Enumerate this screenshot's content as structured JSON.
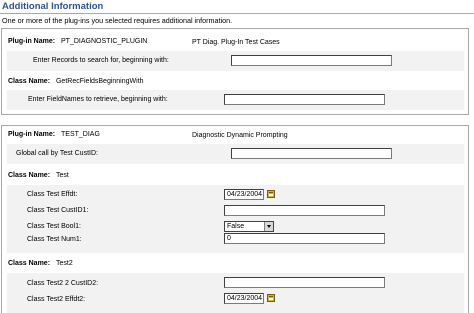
{
  "page": {
    "title": "Additional Information",
    "intro": "One or more of the plug-ins you selected requires additional information."
  },
  "plugin1": {
    "plugin_label": "Plug-in Name:",
    "plugin_name": "PT_DIAGNOSTIC_PLUGIN",
    "plugin_desc": "PT Diag. Plug-In Test Cases",
    "records_label": "Enter Records to search for, beginning with:",
    "records_value": "",
    "class_label": "Class Name:",
    "class_name": "GetRecFieldsBeginningWith",
    "fieldnames_label": "Enter FieldNames to retrieve, beginning with:",
    "fieldnames_value": ""
  },
  "plugin2": {
    "plugin_label": "Plug-in Name:",
    "plugin_name": "TEST_DIAG",
    "plugin_desc": "Diagnostic Dynamic Prompting",
    "global_label": "Global call by Test CustID:",
    "global_value": "",
    "class1_label": "Class Name:",
    "class1_name": "Test",
    "effdt_label": "Class Test Effdt:",
    "effdt_value": "04/23/2004",
    "custid1_label": "Class Test CustID1:",
    "custid1_value": "",
    "bool1_label": "Class Test Bool1:",
    "bool1_value": "False",
    "num1_label": "Class Test Num1:",
    "num1_value": "0",
    "class2_label": "Class Name:",
    "class2_name": "Test2",
    "custid2_label": "Class Test2 2 CustID2:",
    "custid2_value": "",
    "effdt2_label": "Class Test2 Effdt2:",
    "effdt2_value": "04/23/2004"
  },
  "icons": {
    "calendar": "calendar-icon",
    "dropdown": "chevron-down-icon"
  },
  "colors": {
    "title": "#2f5395",
    "band": "#f2f2f2",
    "border": "#a7a7a7"
  }
}
